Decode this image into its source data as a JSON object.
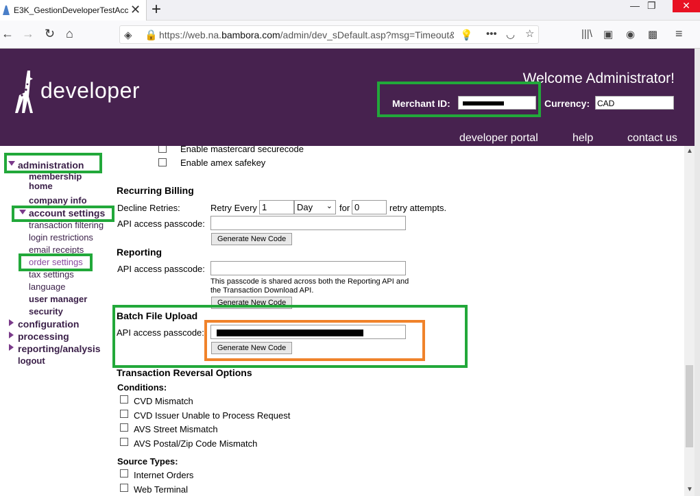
{
  "browser": {
    "tab_title": "E3K_GestionDeveloperTestAcc",
    "url_prefix": "https://web.na.",
    "url_domain": "bambora.com",
    "url_suffix": "/admin/dev_sDefault.asp?msg=Timeout&"
  },
  "header": {
    "logo_text": "developer",
    "welcome": "Welcome Administrator!",
    "merchant_label": "Merchant ID:",
    "currency_label": "Currency:",
    "currency_value": "CAD",
    "links": [
      "developer portal",
      "help",
      "contact us"
    ]
  },
  "sidebar": {
    "administration": "administration",
    "membership_home": "membership home",
    "company_info": "company info",
    "account_settings": "account settings",
    "transaction_filtering": "transaction filtering",
    "login_restrictions": "login restrictions",
    "email_receipts": "email receipts",
    "order_settings": "order settings",
    "tax_settings": "tax settings",
    "language": "language",
    "user_manager": "user manager",
    "security": "security",
    "configuration": "configuration",
    "processing": "processing",
    "reporting_analysis": "reporting/analysis",
    "logout": "logout"
  },
  "main": {
    "mastercard": "Enable mastercard securecode",
    "amex": "Enable amex safekey",
    "recurring_title": "Recurring Billing",
    "decline_retries": "Decline Retries:",
    "retry_every": "Retry Every",
    "retry_value": "1",
    "retry_unit": "Day",
    "for_label": "for",
    "attempts_value": "0",
    "retry_attempts": "retry attempts.",
    "api_passcode": "API access passcode:",
    "generate": "Generate New Code",
    "reporting_title": "Reporting",
    "reporting_note1": "This passcode is shared across both the Reporting API and",
    "reporting_note2": "the Transaction Download API.",
    "batch_title": "Batch File Upload",
    "batch_api": "API access passcode:",
    "reversal_title": "Transaction Reversal Options",
    "conditions": "Conditions:",
    "cvd_mismatch": "CVD Mismatch",
    "cvd_issuer": "CVD Issuer Unable to Process Request",
    "avs_street": "AVS Street Mismatch",
    "avs_postal": "AVS Postal/Zip Code Mismatch",
    "source_types": "Source Types:",
    "internet_orders": "Internet Orders",
    "web_terminal": "Web Terminal"
  }
}
